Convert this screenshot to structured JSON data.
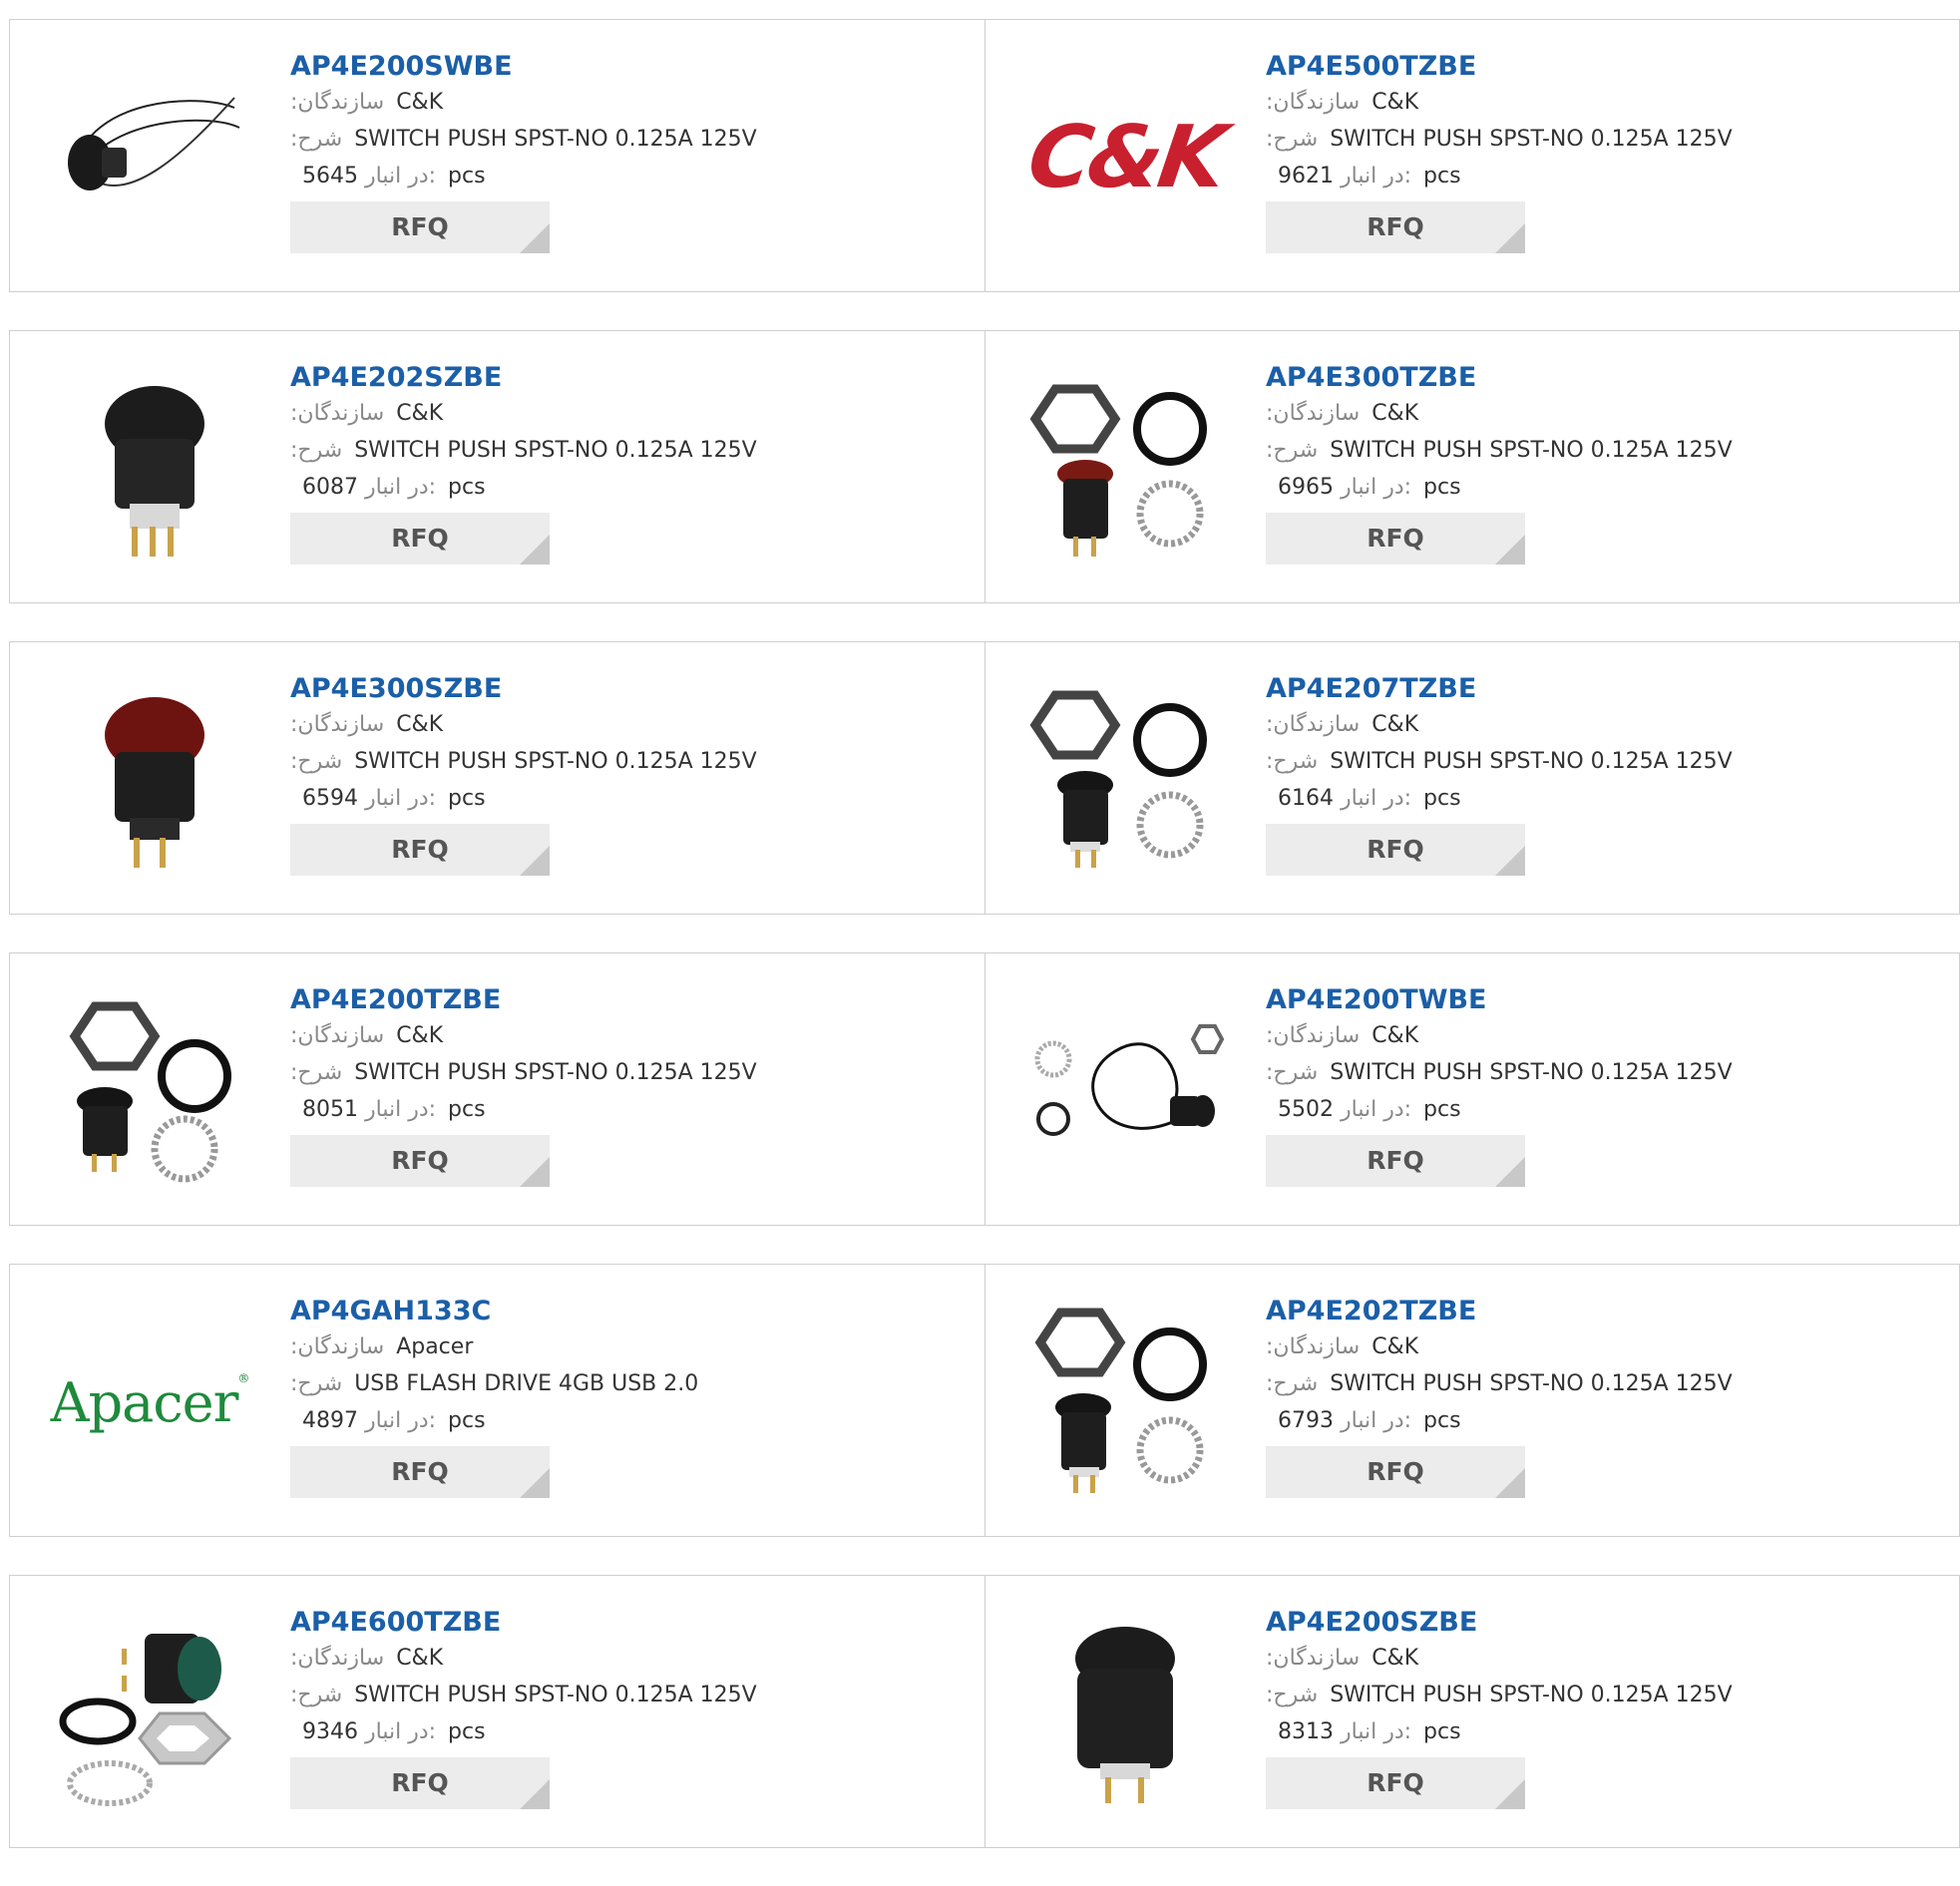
{
  "labels": {
    "manufacturer": ":سازندگان",
    "description": ":شرح",
    "stock": "در انبار:",
    "unit": "pcs",
    "rfq": "RFQ"
  },
  "brand_logos": {
    "ck": "C&K",
    "apacer": "Apacer"
  },
  "products": [
    {
      "name": "AP4E200SWBE",
      "manufacturer": "C&K",
      "description": "SWITCH PUSH SPST-NO 0.125A 125V",
      "stock": "5645",
      "image": "cable-switch-image"
    },
    {
      "name": "AP4E500TZBE",
      "manufacturer": "C&K",
      "description": "SWITCH PUSH SPST-NO 0.125A 125V",
      "stock": "9621",
      "image": "ck-logo"
    },
    {
      "name": "AP4E202SZBE",
      "manufacturer": "C&K",
      "description": "SWITCH PUSH SPST-NO 0.125A 125V",
      "stock": "6087",
      "image": "black-pushbutton-image"
    },
    {
      "name": "AP4E300TZBE",
      "manufacturer": "C&K",
      "description": "SWITCH PUSH SPST-NO 0.125A 125V",
      "stock": "6965",
      "image": "red-switch-kit-image"
    },
    {
      "name": "AP4E300SZBE",
      "manufacturer": "C&K",
      "description": "SWITCH PUSH SPST-NO 0.125A 125V",
      "stock": "6594",
      "image": "red-pushbutton-image"
    },
    {
      "name": "AP4E207TZBE",
      "manufacturer": "C&K",
      "description": "SWITCH PUSH SPST-NO 0.125A 125V",
      "stock": "6164",
      "image": "black-switch-kit-image"
    },
    {
      "name": "AP4E200TZBE",
      "manufacturer": "C&K",
      "description": "SWITCH PUSH SPST-NO 0.125A 125V",
      "stock": "8051",
      "image": "black-switch-kit-image"
    },
    {
      "name": "AP4E200TWBE",
      "manufacturer": "C&K",
      "description": "SWITCH PUSH SPST-NO 0.125A 125V",
      "stock": "5502",
      "image": "cable-switch-kit-image"
    },
    {
      "name": "AP4GAH133C",
      "manufacturer": "Apacer",
      "description": "USB FLASH DRIVE 4GB USB 2.0",
      "stock": "4897",
      "image": "apacer-logo"
    },
    {
      "name": "AP4E202TZBE",
      "manufacturer": "C&K",
      "description": "SWITCH PUSH SPST-NO 0.125A 125V",
      "stock": "6793",
      "image": "black-switch-kit-image"
    },
    {
      "name": "AP4E600TZBE",
      "manufacturer": "C&K",
      "description": "SWITCH PUSH SPST-NO 0.125A 125V",
      "stock": "9346",
      "image": "green-switch-kit-image"
    },
    {
      "name": "AP4E200SZBE",
      "manufacturer": "C&K",
      "description": "SWITCH PUSH SPST-NO 0.125A 125V",
      "stock": "8313",
      "image": "black-pushbutton-image"
    }
  ]
}
